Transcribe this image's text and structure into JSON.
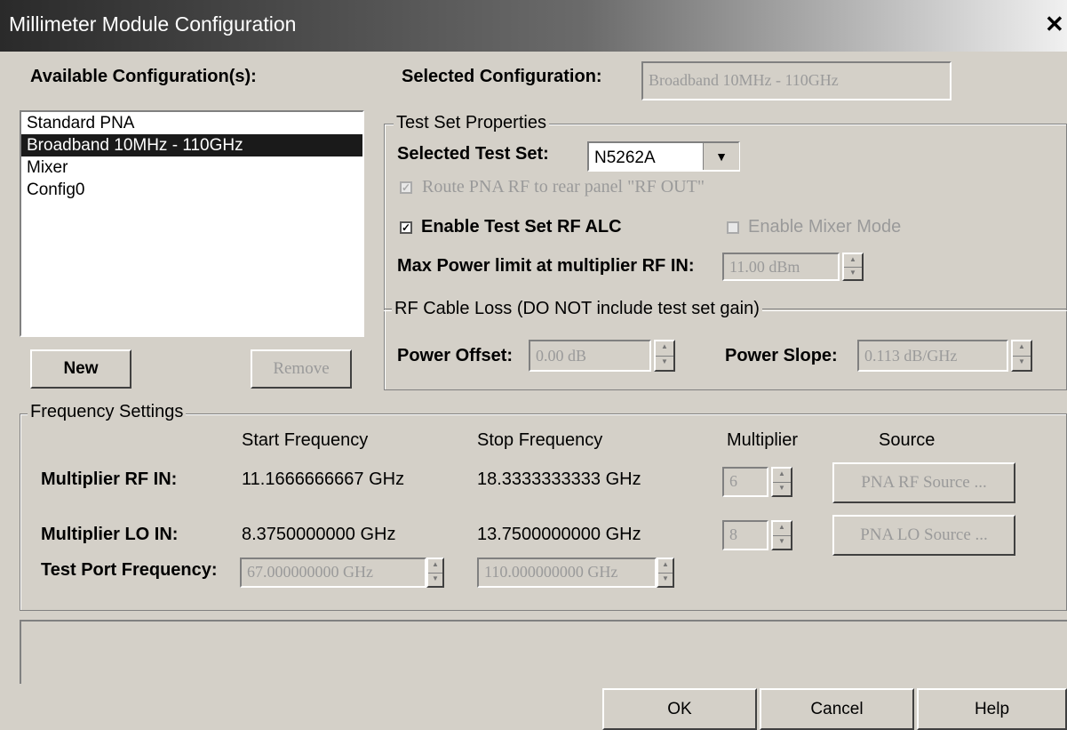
{
  "window": {
    "title": "Millimeter Module Configuration",
    "close_glyph": "✕"
  },
  "available": {
    "label": "Available Configuration(s):",
    "items": [
      "Standard PNA",
      "Broadband 10MHz - 110GHz",
      "Mixer",
      "Config0"
    ],
    "selected_index": 1,
    "new_label": "New",
    "remove_label": "Remove"
  },
  "selected_config": {
    "label": "Selected Configuration:",
    "value": "Broadband 10MHz - 110GHz"
  },
  "test_set": {
    "group_title": "Test Set Properties",
    "selected_label": "Selected Test Set:",
    "selected_value": "N5262A",
    "route_rf_label": "Route PNA RF to rear panel \"RF OUT\"",
    "route_rf_checked": true,
    "enable_alc_label": "Enable Test Set RF ALC",
    "enable_alc_checked": true,
    "mixer_mode_label": "Enable Mixer Mode",
    "mixer_mode_checked": false,
    "max_power_label": "Max Power limit at multiplier RF IN:",
    "max_power_value": "11.00 dBm"
  },
  "cable_loss": {
    "group_title": "RF Cable Loss (DO NOT include test set gain)",
    "power_offset_label": "Power Offset:",
    "power_offset_value": "0.00 dB",
    "power_slope_label": "Power Slope:",
    "power_slope_value": "0.113 dB/GHz"
  },
  "frequency": {
    "group_title": "Frequency Settings",
    "headers": {
      "start": "Start Frequency",
      "stop": "Stop Frequency",
      "multiplier": "Multiplier",
      "source": "Source"
    },
    "rf_in": {
      "label": "Multiplier RF IN:",
      "start": "11.1666666667 GHz",
      "stop": "18.3333333333 GHz",
      "multiplier": "6",
      "source_button": "PNA RF Source ..."
    },
    "lo_in": {
      "label": "Multiplier LO IN:",
      "start": "8.3750000000 GHz",
      "stop": "13.7500000000 GHz",
      "multiplier": "8",
      "source_button": "PNA LO Source ..."
    },
    "test_port": {
      "label": "Test Port Frequency:",
      "start": "67.000000000 GHz",
      "stop": "110.000000000 GHz"
    }
  },
  "footer": {
    "ok_label": "OK",
    "cancel_label": "Cancel",
    "help_label": "Help"
  }
}
